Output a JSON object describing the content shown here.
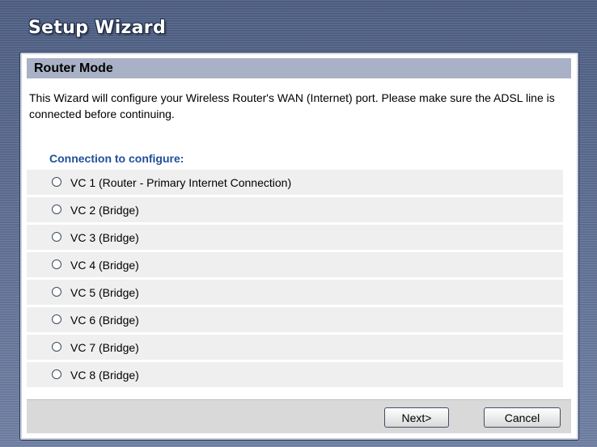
{
  "wizard": {
    "title": "Setup Wizard"
  },
  "section": {
    "title": "Router Mode",
    "description": "This Wizard will configure your Wireless Router's WAN (Internet) port. Please make sure the ADSL line is connected before continuing."
  },
  "connection": {
    "label": "Connection to configure:",
    "options": [
      {
        "label": "VC 1 (Router - Primary Internet Connection)",
        "selected": false
      },
      {
        "label": "VC 2 (Bridge)",
        "selected": false
      },
      {
        "label": "VC 3 (Bridge)",
        "selected": false
      },
      {
        "label": "VC 4 (Bridge)",
        "selected": false
      },
      {
        "label": "VC 5 (Bridge)",
        "selected": false
      },
      {
        "label": "VC 6 (Bridge)",
        "selected": false
      },
      {
        "label": "VC 7 (Bridge)",
        "selected": false
      },
      {
        "label": "VC 8 (Bridge)",
        "selected": false
      }
    ]
  },
  "buttons": {
    "next_label": "Next>",
    "cancel_label": "Cancel"
  }
}
